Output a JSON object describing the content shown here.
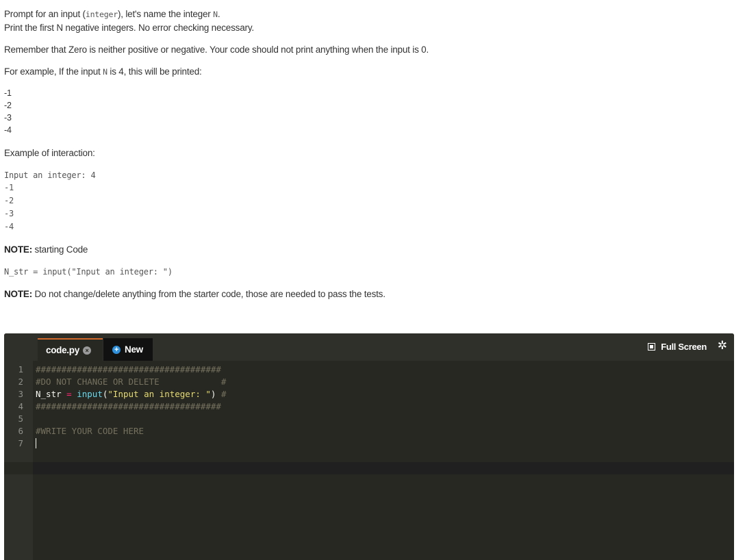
{
  "instructions": {
    "p1_pre": "Prompt for an input (",
    "p1_code": "integer",
    "p1_mid": "), let's name the integer ",
    "p1_var": "N",
    "p1_end": ".",
    "p2": "Print the first N negative integers.  No error checking necessary.",
    "p3": "Remember that Zero is neither positive or negative. Your code should not print anything when the input is 0.",
    "p4_pre": "For example, If the input ",
    "p4_var": "N",
    "p4_end": " is 4, this will be printed:",
    "example_output": [
      "-1",
      "-2",
      "-3",
      "-4"
    ],
    "interaction_label": "Example of interaction:",
    "interaction": [
      "Input an integer: 4",
      "-1",
      "-2",
      "-3",
      "-4"
    ],
    "note1_bold": "NOTE:",
    "note1_text": " starting Code",
    "starter_code": "N_str = input(\"Input an integer: \")",
    "note2_bold": "NOTE:",
    "note2_text": " Do not change/delete anything from the starter code, those are needed to pass the tests."
  },
  "editor": {
    "tab_name": "code.py",
    "tab_close": "×",
    "new_label": "New",
    "new_plus": "+",
    "fullscreen_label": "Full Screen",
    "gear": "✲",
    "line_numbers": [
      "1",
      "2",
      "3",
      "4",
      "5",
      "6",
      "7"
    ],
    "line1": "####################################",
    "line2": "#DO NOT CHANGE OR DELETE            #",
    "line3_var": "N_str",
    "line3_eq": "=",
    "line3_fn": "input",
    "line3_open": "(",
    "line3_str": "\"Input an integer: \"",
    "line3_close": ")",
    "line3_hash": "#",
    "line4": "####################################",
    "line5": "",
    "line6": "#WRITE YOUR CODE HERE",
    "line7": ""
  },
  "colors": {
    "editor_bg": "#272822",
    "tab_accent": "#d36a2c",
    "new_icon": "#2f8fdb"
  }
}
